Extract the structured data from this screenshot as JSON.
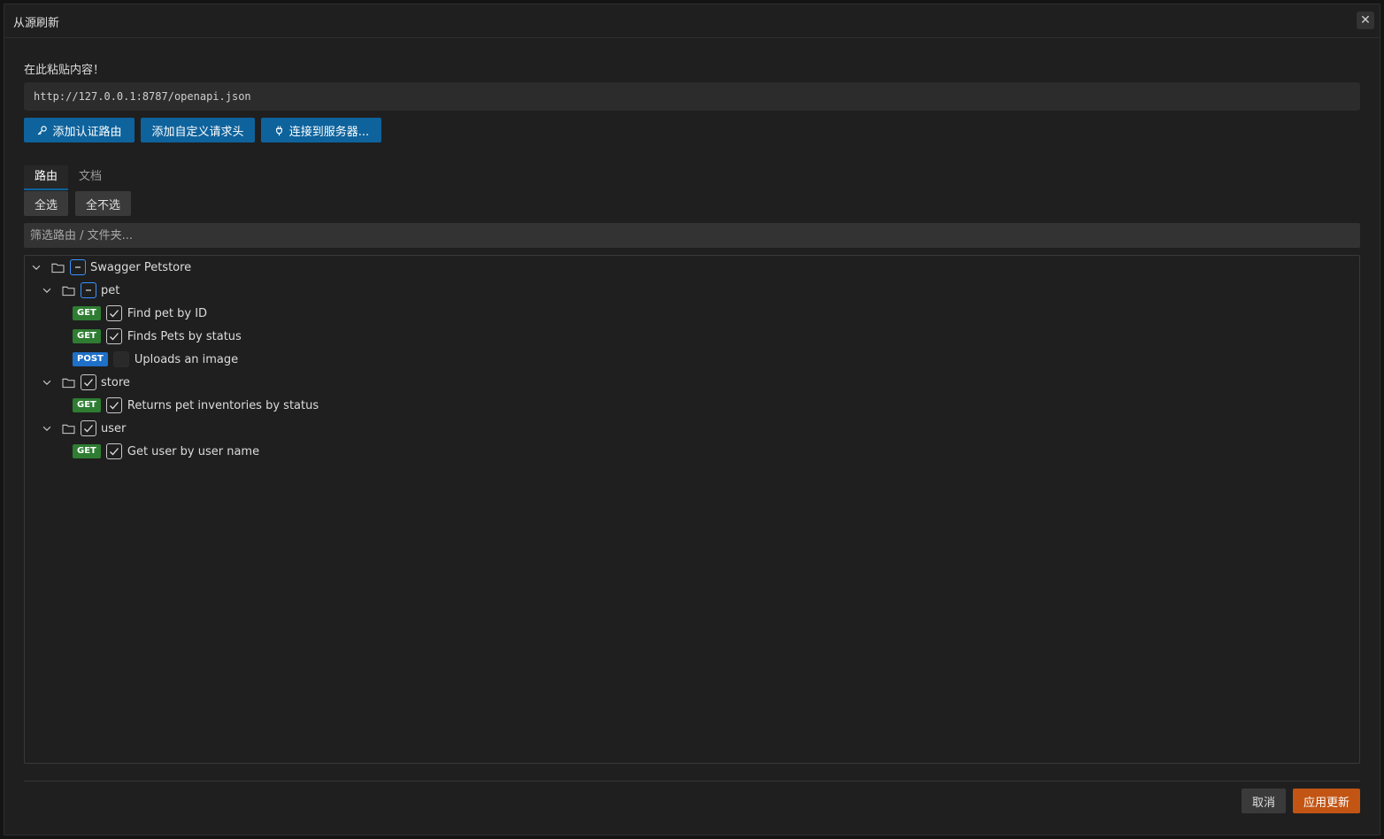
{
  "dialog": {
    "title": "从源刷新",
    "close_glyph": "✕"
  },
  "source": {
    "label": "在此粘贴内容！",
    "url_value": "http://127.0.0.1:8787/openapi.json"
  },
  "actions": {
    "add_auth_route": "添加认证路由",
    "add_custom_header": "添加自定义请求头",
    "connect_server": "连接到服务器..."
  },
  "tabs": [
    {
      "label": "路由",
      "active": true
    },
    {
      "label": "文档",
      "active": false
    }
  ],
  "selection": {
    "select_all": "全选",
    "select_none": "全不选"
  },
  "filter": {
    "placeholder": "筛选路由 / 文件夹..."
  },
  "tree": {
    "root": {
      "label": "Swagger Petstore",
      "state": "mixed",
      "expanded": true
    },
    "folders": [
      {
        "label": "pet",
        "state": "mixed",
        "expanded": true,
        "routes": [
          {
            "method": "GET",
            "label": "Find pet by ID",
            "checked": true
          },
          {
            "method": "GET",
            "label": "Finds Pets by status",
            "checked": true
          },
          {
            "method": "POST",
            "label": "Uploads an image",
            "checked": false
          }
        ]
      },
      {
        "label": "store",
        "state": "checked",
        "expanded": true,
        "routes": [
          {
            "method": "GET",
            "label": "Returns pet inventories by status",
            "checked": true
          }
        ]
      },
      {
        "label": "user",
        "state": "checked",
        "expanded": true,
        "routes": [
          {
            "method": "GET",
            "label": "Get user by user name",
            "checked": true
          }
        ]
      }
    ]
  },
  "footer": {
    "cancel": "取消",
    "apply": "应用更新"
  },
  "colors": {
    "primary_button": "#0e639c",
    "apply_button": "#c25514",
    "get_badge": "#2e7d32",
    "post_badge": "#1e70c8",
    "mixed_checkbox": "#3794ff"
  },
  "icons": {
    "auth": "key-icon",
    "connect": "plug-icon",
    "folder": "folder-icon",
    "expand": "chevron-down-icon",
    "close": "close-icon"
  }
}
